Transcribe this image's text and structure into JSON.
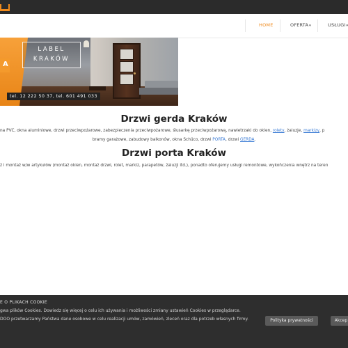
{
  "nav": {
    "items": [
      {
        "label": "HOME",
        "active": true
      },
      {
        "label": "OFERTA",
        "caret": "▾"
      },
      {
        "label": "USŁUGI",
        "caret": "▾"
      }
    ],
    "accent": "#f08a1c"
  },
  "banner": {
    "line1": "LABEL",
    "line2": "KRAKÓW",
    "contact": "tel. 12 222 50 37, tel. 601 491 033"
  },
  "section1": {
    "title": "Drzwi gerda Kraków",
    "text_a": "na PVC, okna aluminiowe, drzwi przeciwpożarowe, zabezpieczenia przeciwpożarowe, ślusarkę przeciwpożarową, nawietrzaki do okien,",
    "link_rolety": "rolety",
    "text_b": ", żaluzje,",
    "link_markizy": "markizy",
    "text_c": ", p",
    "text_d": "bramy garażowe, zabudowy balkonów, okna Schüco, drzwi",
    "link_porta": "PORTA",
    "text_e": ", drzwi",
    "link_gerda": "GERDA",
    "text_f": "."
  },
  "section2": {
    "title": "Drzwi porta Kraków",
    "text": "ż i montaż w/w artykułów (montaż okien, montaż drzwi, rolet, markiz, parapetów, żaluzji itd.), ponadto oferujemy usługi remontowe, wykończenia wnętrz na teren"
  },
  "cookie": {
    "title": "E O PLIKACH COOKIE",
    "line1": "gwa plików Cookies. Dowiedz się więcej o celu ich używania i możliwości zmiany ustawień Cookies w przeglądarce.",
    "line2": "DOO przetwarzamy Państwa dane osobowe w celu realizacji umów, zamówień, zleceń oraz dla potrzeb własnych firmy.",
    "privacy_button": "Polityka prywatności",
    "accept_button": "Akcep"
  }
}
